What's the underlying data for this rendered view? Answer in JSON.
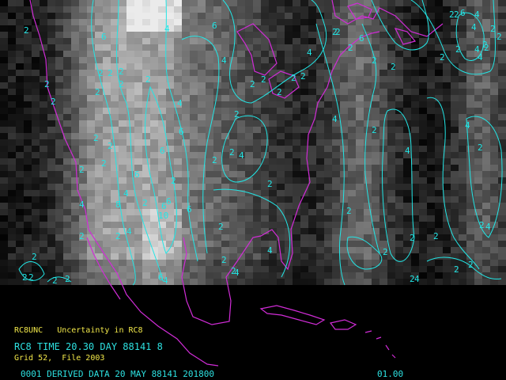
{
  "map": {
    "product_code": "RC8UNC",
    "product_desc": "Uncertainty in RC8",
    "time_line": "RC8 TIME 20.30 DAY 88141 8",
    "grid_line": "Grid 52,  File 2003",
    "status_line": "0001 DERIVED DATA 20 MAY 88141 201800",
    "status_value": "01.00",
    "colors": {
      "coastline": "#d02cd6",
      "contour": "#22e6e6",
      "caption_yellow": "#f2e84a",
      "background": "#000000"
    },
    "contour_labels": [
      "2",
      "6",
      "4",
      "6",
      "2",
      "2",
      "2",
      "2",
      "4",
      "2",
      "2",
      "2",
      "2",
      "2",
      "2",
      "2",
      "2",
      "4",
      "4",
      "2",
      "2",
      "2",
      "2",
      "2",
      "2",
      "2",
      "6",
      "4",
      "2",
      "4",
      "2",
      "6",
      "6",
      "2",
      "2",
      "2",
      "2",
      "2",
      "4",
      "2",
      "4",
      "6",
      "2",
      "4",
      "2",
      "4",
      "8",
      "2",
      "6",
      "6",
      "6",
      "2",
      "2",
      "10",
      "2",
      "2",
      "4",
      "2",
      "4",
      "2",
      "4",
      "2",
      "2",
      "2",
      "2",
      "2",
      "2",
      "4",
      "2",
      "4",
      "2",
      "2",
      "2",
      "2",
      "4",
      "2",
      "2",
      "4",
      "2",
      "4",
      "2",
      "4",
      "6",
      "4",
      "2",
      "2",
      "2",
      "2",
      "6",
      "2"
    ]
  }
}
